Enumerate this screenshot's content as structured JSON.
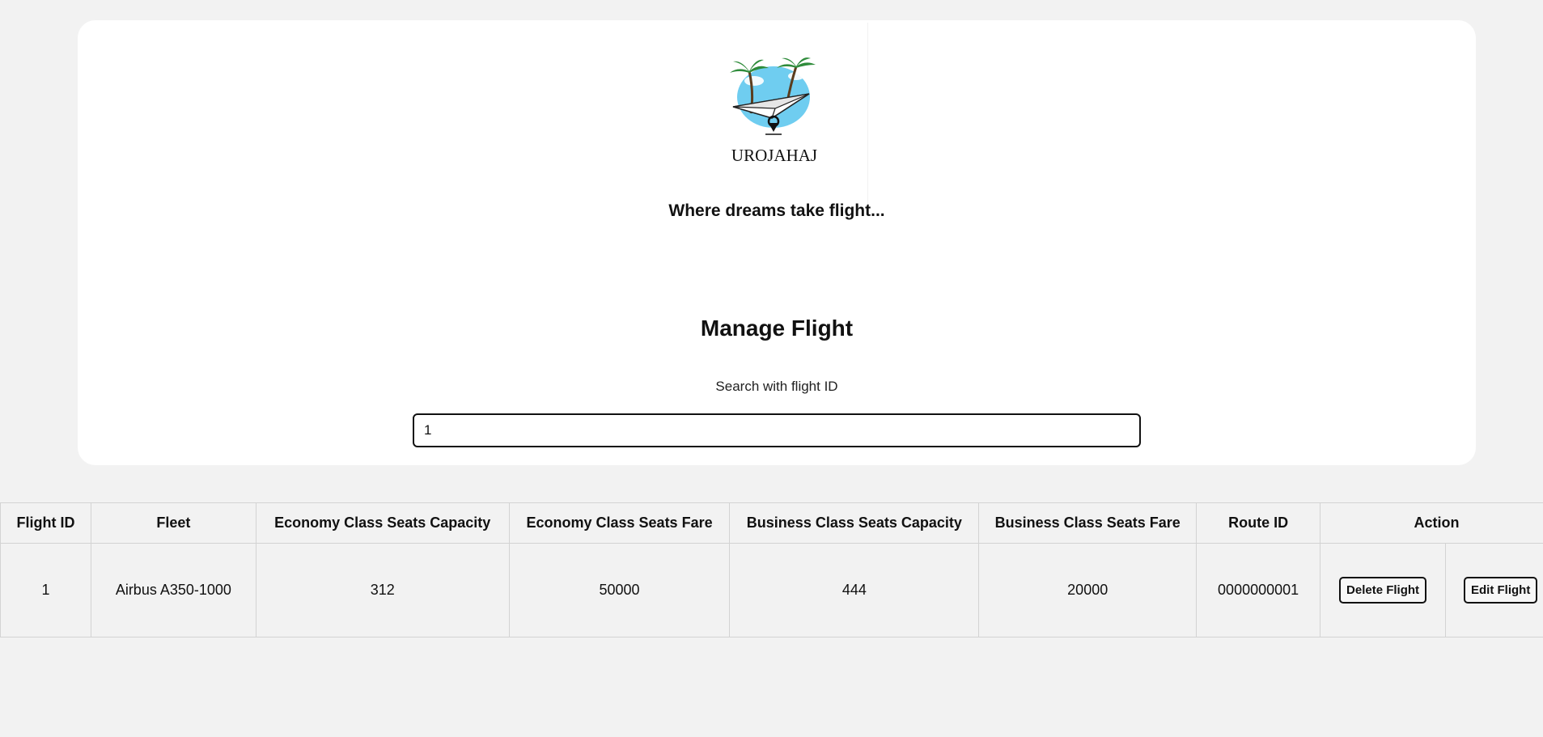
{
  "brand": {
    "name": "UROJAHAJ",
    "tagline": "Where dreams take flight..."
  },
  "page": {
    "title": "Manage Flight"
  },
  "search": {
    "label": "Search with flight ID",
    "value": "1"
  },
  "table": {
    "headers": {
      "flight_id": "Flight ID",
      "fleet": "Fleet",
      "econ_capacity": "Economy Class Seats Capacity",
      "econ_fare": "Economy Class Seats Fare",
      "bus_capacity": "Business Class Seats Capacity",
      "bus_fare": "Business Class Seats Fare",
      "route_id": "Route ID",
      "action": "Action"
    },
    "rows": [
      {
        "flight_id": "1",
        "fleet": "Airbus A350-1000",
        "econ_capacity": "312",
        "econ_fare": "50000",
        "bus_capacity": "444",
        "bus_fare": "20000",
        "route_id": "0000000001",
        "delete_label": "Delete Flight",
        "edit_label": "Edit Flight"
      }
    ]
  },
  "colors": {
    "background": "#f2f2f2",
    "card": "#ffffff",
    "sky": "#6fcdf0",
    "palm": "#2e8b3a"
  }
}
